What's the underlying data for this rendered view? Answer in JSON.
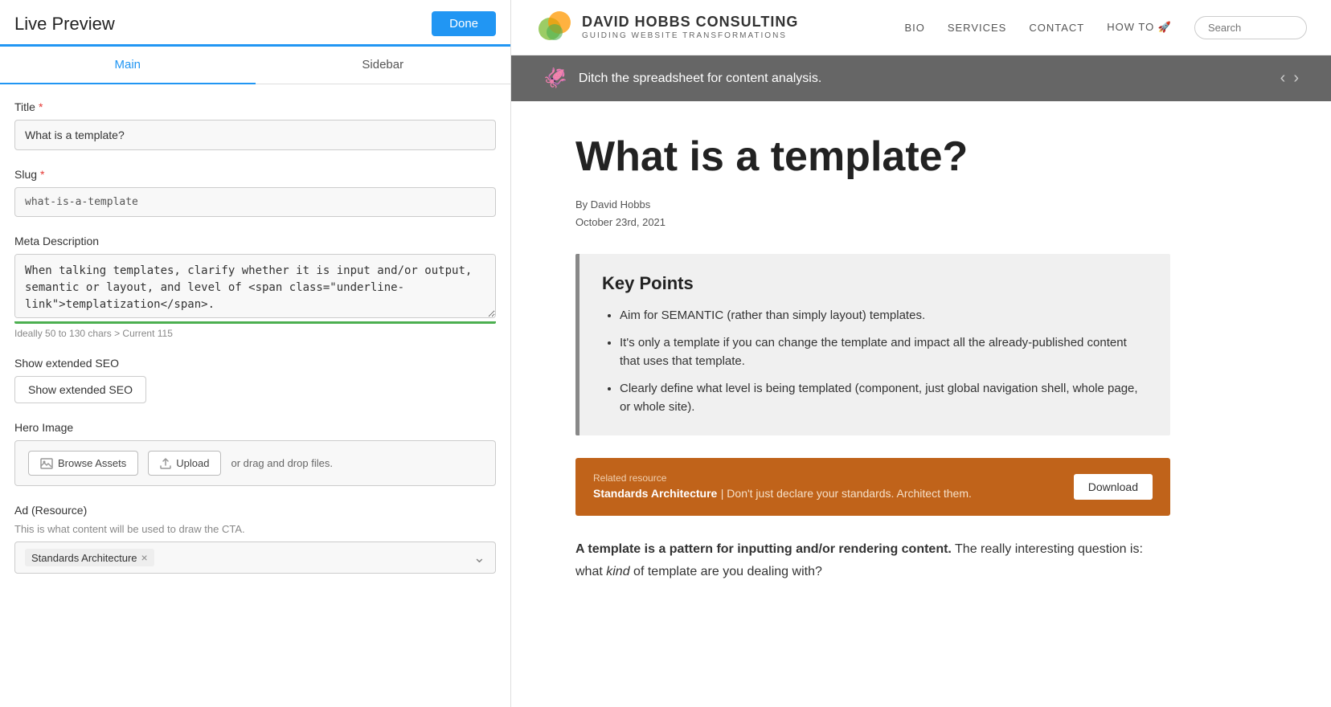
{
  "left_panel": {
    "header_title": "Live Preview",
    "done_button": "Done",
    "tabs": [
      {
        "label": "Main",
        "active": true
      },
      {
        "label": "Sidebar",
        "active": false
      }
    ],
    "fields": {
      "title": {
        "label": "Title",
        "required": true,
        "value": "What is a template?"
      },
      "slug": {
        "label": "Slug",
        "required": true,
        "value": "what-is-a-template"
      },
      "meta_description": {
        "label": "Meta Description",
        "value": "When talking templates, clarify whether it is input and/or output, semantic or layout, and level of templatization.",
        "link_text": "templatization",
        "hint": "Ideally 50 to 130 chars > Current 115"
      },
      "show_seo": {
        "section_label": "Show extended SEO",
        "button_label": "Show extended SEO"
      },
      "hero_image": {
        "label": "Hero Image",
        "browse_label": "Browse Assets",
        "upload_label": "Upload",
        "drag_drop": "or drag and drop files."
      },
      "ad_resource": {
        "label": "Ad (Resource)",
        "hint": "This is what content will be used to draw the CTA.",
        "selected_value": "Standards Architecture"
      }
    }
  },
  "right_panel": {
    "nav": {
      "logo_main": "DAVID HOBBS CONSULTING",
      "logo_sub": "GUIDING WEBSITE TRANSFORMATIONS",
      "links": [
        "BIO",
        "SERVICES",
        "CONTACT",
        "HOW TO"
      ],
      "search_placeholder": "Search"
    },
    "banner": {
      "text": "Ditch the spreadsheet for content analysis."
    },
    "article": {
      "title": "What is a template?",
      "author": "By David Hobbs",
      "date": "October 23rd, 2021",
      "key_points_title": "Key Points",
      "key_points": [
        "Aim for SEMANTIC (rather than simply layout) templates.",
        "It's only a template if you can change the template and impact all the already-published content that uses that template.",
        "Clearly define what level is being templated (component, just global navigation shell, whole page, or whole site)."
      ],
      "related_label": "Related resource",
      "related_title": "Standards Architecture",
      "related_desc": " | Don't just declare your standards. Architect them.",
      "download_button": "Download",
      "body_bold": "A template is a pattern for inputting and/or rendering content.",
      "body_rest": " The really interesting question is: what ",
      "body_italic": "kind",
      "body_end": " of template are you dealing with?"
    }
  }
}
